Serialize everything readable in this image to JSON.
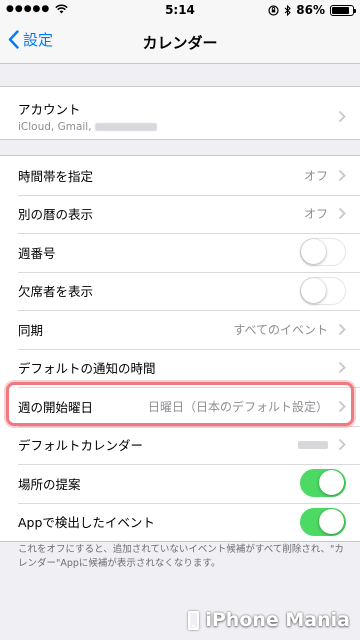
{
  "status_bar": {
    "time": "5:14",
    "battery_percent_text": "86%",
    "battery_level": 0.86
  },
  "nav": {
    "back_label": "設定",
    "title": "カレンダー"
  },
  "account": {
    "title": "アカウント",
    "subtitle": "iCloud, Gmail,"
  },
  "settings": {
    "time_zone": {
      "label": "時間帯を指定",
      "value": "オフ"
    },
    "alt_calendar": {
      "label": "別の暦の表示",
      "value": "オフ"
    },
    "week_numbers": {
      "label": "週番号",
      "on": false
    },
    "declined": {
      "label": "欠席者を表示",
      "on": false
    },
    "sync": {
      "label": "同期",
      "value": "すべてのイベント"
    },
    "default_alerts": {
      "label": "デフォルトの通知の時間"
    },
    "week_start": {
      "label": "週の開始曜日",
      "value": "日曜日（日本のデフォルト設定）"
    },
    "default_calendar": {
      "label": "デフォルトカレンダー"
    },
    "location_suggestions": {
      "label": "場所の提案",
      "on": true
    },
    "events_found_in_apps": {
      "label": "Appで検出したイベント",
      "on": true
    }
  },
  "footer_note": "これをオフにすると、追加されていないイベント候補がすべて削除され、\"カレンダー\"Appに候補が表示されなくなります。",
  "watermark": "iPhone Mania",
  "colors": {
    "accent": "#007aff",
    "toggle_on": "#4cd964",
    "highlight": "#f0787f",
    "background": "#efeff4"
  }
}
